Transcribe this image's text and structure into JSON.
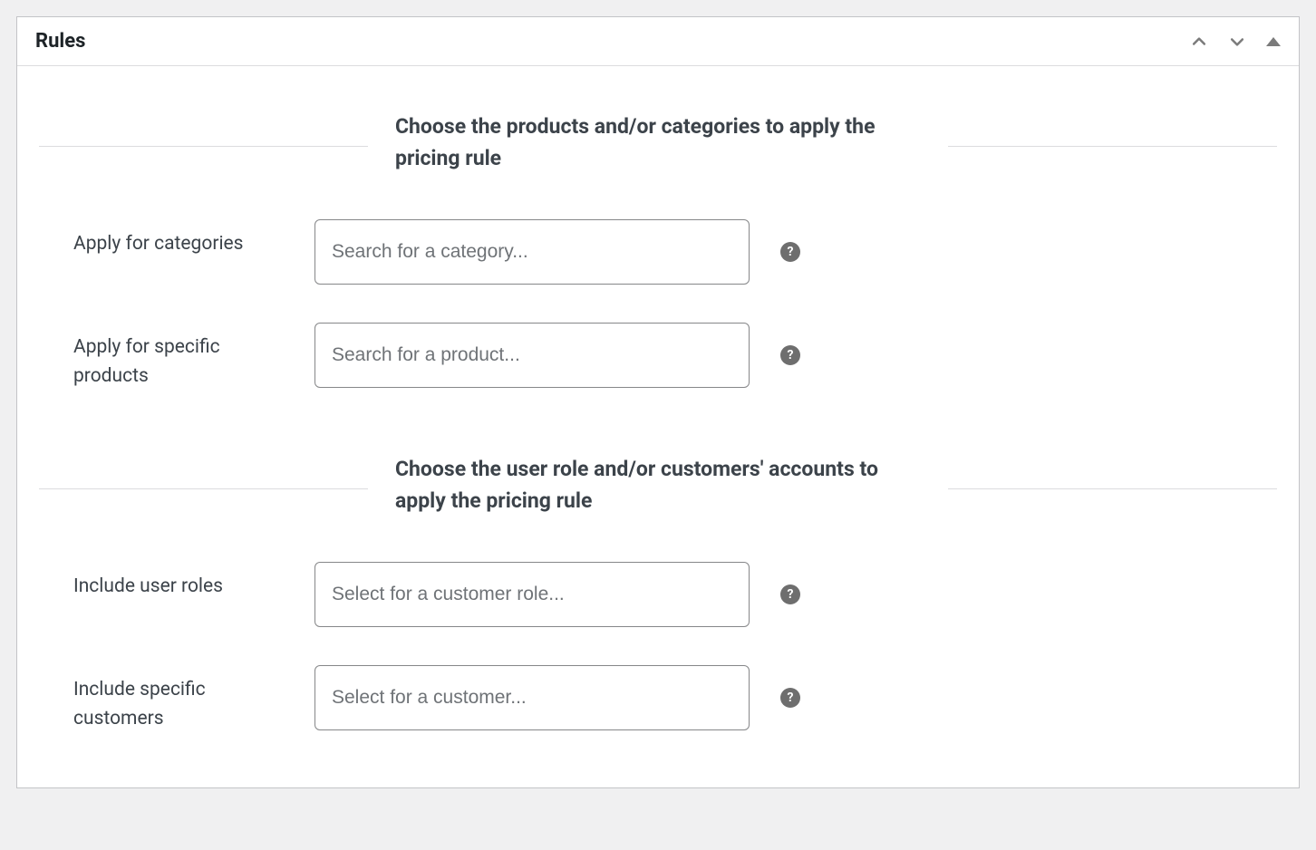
{
  "panel": {
    "title": "Rules"
  },
  "sections": {
    "products": {
      "heading": "Choose the products and/or categories to apply the pricing rule",
      "fields": {
        "categories": {
          "label": "Apply for categories",
          "placeholder": "Search for a category..."
        },
        "products": {
          "label": "Apply for specific products",
          "placeholder": "Search for a product..."
        }
      }
    },
    "users": {
      "heading": "Choose the user role and/or customers' accounts to apply the pricing rule",
      "fields": {
        "roles": {
          "label": "Include user roles",
          "placeholder": "Select for a customer role..."
        },
        "customers": {
          "label": "Include specific customers",
          "placeholder": "Select for a customer..."
        }
      }
    }
  },
  "help_glyph": "?"
}
